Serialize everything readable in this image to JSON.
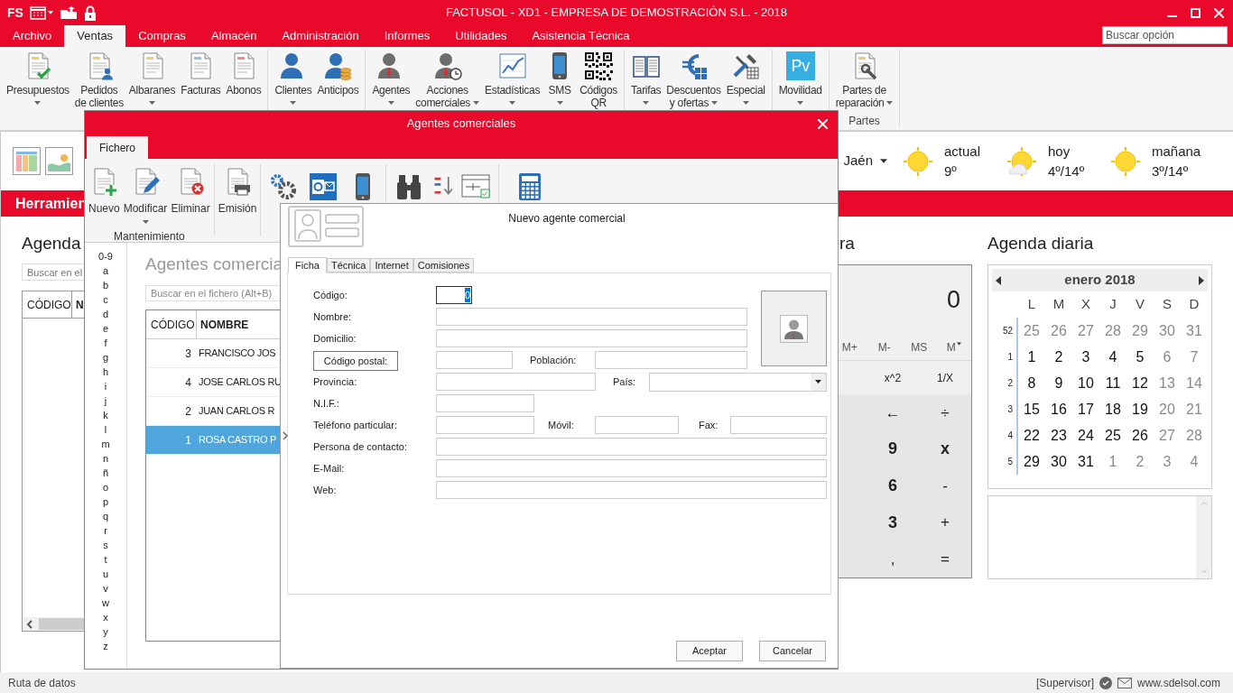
{
  "app": {
    "logo": "FS",
    "title": "FACTUSOL - XD1 - EMPRESA DE DEMOSTRACIÓN S.L. - 2018"
  },
  "menu": [
    {
      "label": "Archivo",
      "selected": false
    },
    {
      "label": "Ventas",
      "selected": true
    },
    {
      "label": "Compras",
      "selected": false
    },
    {
      "label": "Almacén",
      "selected": false
    },
    {
      "label": "Administración",
      "selected": false
    },
    {
      "label": "Informes",
      "selected": false
    },
    {
      "label": "Utilidades",
      "selected": false
    },
    {
      "label": "Asistencia Técnica",
      "selected": false
    }
  ],
  "search_option": {
    "placeholder": "Buscar opción"
  },
  "ribbon": {
    "groups": [
      {
        "buttons": [
          {
            "lines": [
              "Presupuestos"
            ],
            "dropdown": true
          },
          {
            "lines": [
              "Pedidos",
              "de clientes"
            ],
            "dropdown": false
          },
          {
            "lines": [
              "Albaranes"
            ],
            "dropdown": true
          },
          {
            "lines": [
              "Facturas"
            ],
            "dropdown": false
          },
          {
            "lines": [
              "Abonos"
            ],
            "dropdown": false
          }
        ]
      },
      {
        "buttons": [
          {
            "lines": [
              "Clientes"
            ],
            "dropdown": true
          },
          {
            "lines": [
              "Anticipos"
            ],
            "dropdown": false
          }
        ]
      },
      {
        "buttons": [
          {
            "lines": [
              "Agentes"
            ],
            "dropdown": true
          },
          {
            "lines": [
              "Acciones",
              "comerciales"
            ],
            "dropdown": true
          },
          {
            "lines": [
              "Estadísticas"
            ],
            "dropdown": true
          },
          {
            "lines": [
              "SMS"
            ],
            "dropdown": true
          },
          {
            "lines": [
              "Códigos",
              "QR"
            ],
            "dropdown": false
          }
        ]
      },
      {
        "buttons": [
          {
            "lines": [
              "Tarifas"
            ],
            "dropdown": true
          },
          {
            "lines": [
              "Descuentos",
              "y ofertas"
            ],
            "dropdown": true
          },
          {
            "lines": [
              "Especial"
            ],
            "dropdown": true
          }
        ]
      },
      {
        "buttons": [
          {
            "lines": [
              "Movilidad"
            ],
            "dropdown": true,
            "tile": "Pv"
          }
        ]
      },
      {
        "label": "Partes",
        "buttons": [
          {
            "lines": [
              "Partes de",
              "reparación"
            ],
            "dropdown": true
          }
        ]
      }
    ]
  },
  "tools_bar": {
    "title": "Herramien"
  },
  "weather": {
    "city": "Jaén",
    "items": [
      {
        "kind": "sun",
        "label": "actual",
        "temp": "9º"
      },
      {
        "kind": "sun-cloud",
        "label": "hoy",
        "temp": "4º/14º"
      },
      {
        "kind": "sun",
        "label": "mañana",
        "temp": "3º/14º"
      }
    ]
  },
  "agenda": {
    "title": "Agenda",
    "search_placeholder": "Buscar en el",
    "columns": [
      "CÓDIGO",
      "N"
    ]
  },
  "calculator": {
    "title": "ra",
    "display": "0",
    "memory": [
      {
        "label": "M+",
        "dropdown": false
      },
      {
        "label": "M-",
        "dropdown": false
      },
      {
        "label": "MS",
        "dropdown": false
      },
      {
        "label": "M",
        "dropdown": true
      }
    ],
    "functions": [
      "x^2",
      "1/X"
    ],
    "keys": [
      [
        {
          "label": "←",
          "kind": "op"
        },
        {
          "label": "÷",
          "kind": "op"
        }
      ],
      [
        {
          "label": "9",
          "kind": "digit"
        },
        {
          "label": "x",
          "kind": "digit"
        }
      ],
      [
        {
          "label": "6",
          "kind": "digit"
        },
        {
          "label": "-",
          "kind": "op"
        }
      ],
      [
        {
          "label": "3",
          "kind": "digit"
        },
        {
          "label": "+",
          "kind": "op"
        }
      ],
      [
        {
          "label": ",",
          "kind": "op"
        },
        {
          "label": "=",
          "kind": "op"
        }
      ]
    ]
  },
  "daily_agenda": {
    "title": "Agenda diaria",
    "calendar": {
      "month": "enero 2018",
      "weekdays": [
        "L",
        "M",
        "X",
        "J",
        "V",
        "S",
        "D"
      ],
      "weeks": [
        {
          "number": "52",
          "days": [
            {
              "day": "25",
              "muted": true
            },
            {
              "day": "26",
              "muted": true
            },
            {
              "day": "27",
              "muted": true
            },
            {
              "day": "28",
              "muted": true
            },
            {
              "day": "29",
              "muted": true
            },
            {
              "day": "30",
              "muted": true
            },
            {
              "day": "31",
              "muted": true
            }
          ]
        },
        {
          "number": "1",
          "days": [
            {
              "day": "1",
              "muted": false
            },
            {
              "day": "2",
              "muted": false
            },
            {
              "day": "3",
              "muted": false
            },
            {
              "day": "4",
              "muted": false
            },
            {
              "day": "5",
              "muted": false
            },
            {
              "day": "6",
              "muted": true
            },
            {
              "day": "7",
              "muted": true
            }
          ]
        },
        {
          "number": "2",
          "days": [
            {
              "day": "8",
              "muted": false
            },
            {
              "day": "9",
              "muted": false
            },
            {
              "day": "10",
              "muted": false
            },
            {
              "day": "11",
              "muted": false
            },
            {
              "day": "12",
              "muted": false
            },
            {
              "day": "13",
              "muted": true
            },
            {
              "day": "14",
              "muted": true
            }
          ]
        },
        {
          "number": "3",
          "days": [
            {
              "day": "15",
              "muted": false
            },
            {
              "day": "16",
              "muted": false
            },
            {
              "day": "17",
              "muted": false
            },
            {
              "day": "18",
              "muted": false
            },
            {
              "day": "19",
              "muted": false
            },
            {
              "day": "20",
              "muted": true
            },
            {
              "day": "21",
              "muted": true
            }
          ]
        },
        {
          "number": "4",
          "days": [
            {
              "day": "22",
              "muted": false
            },
            {
              "day": "23",
              "muted": false
            },
            {
              "day": "24",
              "muted": false
            },
            {
              "day": "25",
              "muted": false
            },
            {
              "day": "26",
              "muted": false
            },
            {
              "day": "27",
              "muted": true
            },
            {
              "day": "28",
              "muted": true
            }
          ]
        },
        {
          "number": "5",
          "days": [
            {
              "day": "29",
              "muted": false
            },
            {
              "day": "30",
              "muted": false
            },
            {
              "day": "31",
              "muted": false
            },
            {
              "day": "1",
              "muted": true
            },
            {
              "day": "2",
              "muted": true
            },
            {
              "day": "3",
              "muted": true
            },
            {
              "day": "4",
              "muted": true
            }
          ]
        }
      ]
    }
  },
  "status_bar": {
    "left": "Ruta de datos",
    "user": "[Supervisor]",
    "site": "www.sdelsol.com"
  },
  "agents_window": {
    "title": "Agentes comerciales",
    "tabs": [
      {
        "label": "Fichero",
        "selected": true
      }
    ],
    "ribbon": {
      "groups": [
        {
          "label": "Mantenimiento",
          "buttons": [
            {
              "label": "Nuevo",
              "dropdown": false
            },
            {
              "label": "Modificar",
              "dropdown": true
            },
            {
              "label": "Eliminar",
              "dropdown": false
            }
          ]
        },
        {
          "buttons": [
            {
              "label": "Emisión",
              "dropdown": false
            }
          ]
        }
      ]
    },
    "index": [
      "0-9",
      "a",
      "b",
      "c",
      "d",
      "e",
      "f",
      "g",
      "h",
      "i",
      "j",
      "k",
      "l",
      "m",
      "n",
      "ñ",
      "o",
      "p",
      "q",
      "r",
      "s",
      "t",
      "u",
      "v",
      "w",
      "x",
      "y",
      "z"
    ],
    "list": {
      "title": "Agentes comercia",
      "search_placeholder": "Buscar en el fichero (Alt+B)",
      "columns": [
        "CÓDIGO",
        "NOMBRE"
      ],
      "rows": [
        {
          "code": "3",
          "name": "FRANCISCO JOS",
          "selected": false
        },
        {
          "code": "4",
          "name": "JOSE CARLOS RU",
          "selected": false
        },
        {
          "code": "2",
          "name": "JUAN CARLOS R",
          "selected": false
        },
        {
          "code": "1",
          "name": "ROSA CASTRO P",
          "selected": true
        }
      ]
    }
  },
  "new_agent_dialog": {
    "title": "Nuevo agente comercial",
    "tabs": [
      {
        "label": "Ficha",
        "selected": true
      },
      {
        "label": "Técnica",
        "selected": false
      },
      {
        "label": "Internet",
        "selected": false
      },
      {
        "label": "Comisiones",
        "selected": false
      }
    ],
    "rows": [
      {
        "fields": [
          {
            "label": "Código:",
            "kind": "text",
            "value": "0",
            "focused": true
          }
        ]
      },
      {
        "fields": [
          {
            "label": "Nombre:",
            "kind": "text",
            "focused": false
          }
        ]
      },
      {
        "fields": [
          {
            "label": "Domicilio:",
            "kind": "text",
            "focused": false
          }
        ]
      },
      {
        "fields": [
          {
            "label": "Código postal:",
            "kind": "lookup",
            "focused": false
          },
          {
            "label": "Población:",
            "kind": "text",
            "focused": false
          }
        ]
      },
      {
        "fields": [
          {
            "label": "Provincia:",
            "kind": "text",
            "focused": false
          },
          {
            "label": "País:",
            "kind": "select",
            "focused": false
          }
        ]
      },
      {
        "fields": [
          {
            "label": "N.I.F.:",
            "kind": "text",
            "focused": false
          }
        ]
      },
      {
        "fields": [
          {
            "label": "Teléfono particular:",
            "kind": "text",
            "focused": false
          },
          {
            "label": "Móvil:",
            "kind": "text",
            "focused": false
          },
          {
            "label": "Fax:",
            "kind": "text",
            "focused": false
          }
        ]
      },
      {
        "fields": [
          {
            "label": "Persona de contacto:",
            "kind": "text",
            "focused": false
          }
        ]
      },
      {
        "fields": [
          {
            "label": "E-Mail:",
            "kind": "text",
            "focused": false
          }
        ]
      },
      {
        "fields": [
          {
            "label": "Web:",
            "kind": "text",
            "focused": false
          }
        ]
      }
    ],
    "buttons": [
      "Aceptar",
      "Cancelar"
    ]
  }
}
